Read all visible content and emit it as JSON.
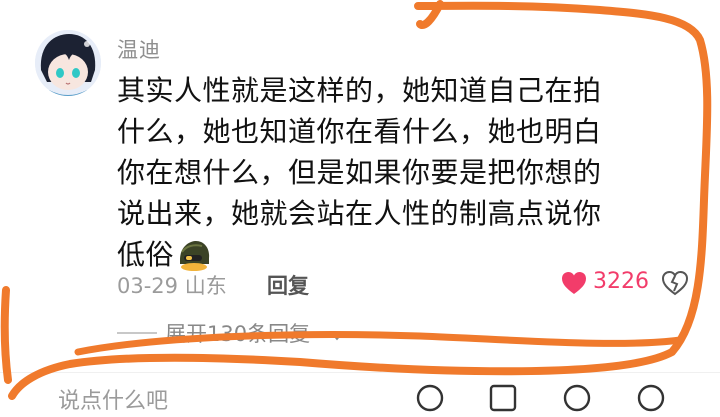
{
  "comment": {
    "username": "温迪",
    "lines": [
      "其实人性就是这样的，她知道自己在拍",
      "什么，她也知道你在看什么，她也明白",
      "你在想什么，但是如果你要是把你想的",
      "说出来，她就会站在人性的制高点说你",
      "低俗"
    ],
    "emoji": "helmet-emoji",
    "date_location": "03-29 山东",
    "reply_label": "回复",
    "like_count": "3226",
    "expand_label": "展开130条回复"
  },
  "input_bar": {
    "hint": "说点什么吧"
  },
  "colors": {
    "like": "#f23c6a",
    "annotation": "#f07a2c"
  }
}
